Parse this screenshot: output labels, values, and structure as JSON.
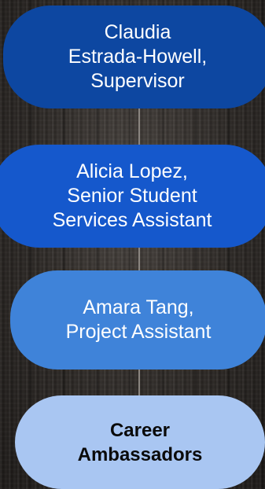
{
  "org_chart": {
    "nodes": [
      {
        "text": "Claudia\nEstrada-Howell,\nSupervisor",
        "fill": "#0d47a1",
        "text_color": "#ffffff"
      },
      {
        "text": "Alicia Lopez,\nSenior Student\nServices Assistant",
        "fill": "#1558cc",
        "text_color": "#ffffff"
      },
      {
        "text": "Amara Tang,\nProject Assistant",
        "fill": "#3f83d9",
        "text_color": "#ffffff"
      },
      {
        "text": "Career\nAmbassadors",
        "fill": "#a9c6f2",
        "text_color": "#0a0a0a"
      }
    ],
    "connector_color": "#8a8580"
  }
}
